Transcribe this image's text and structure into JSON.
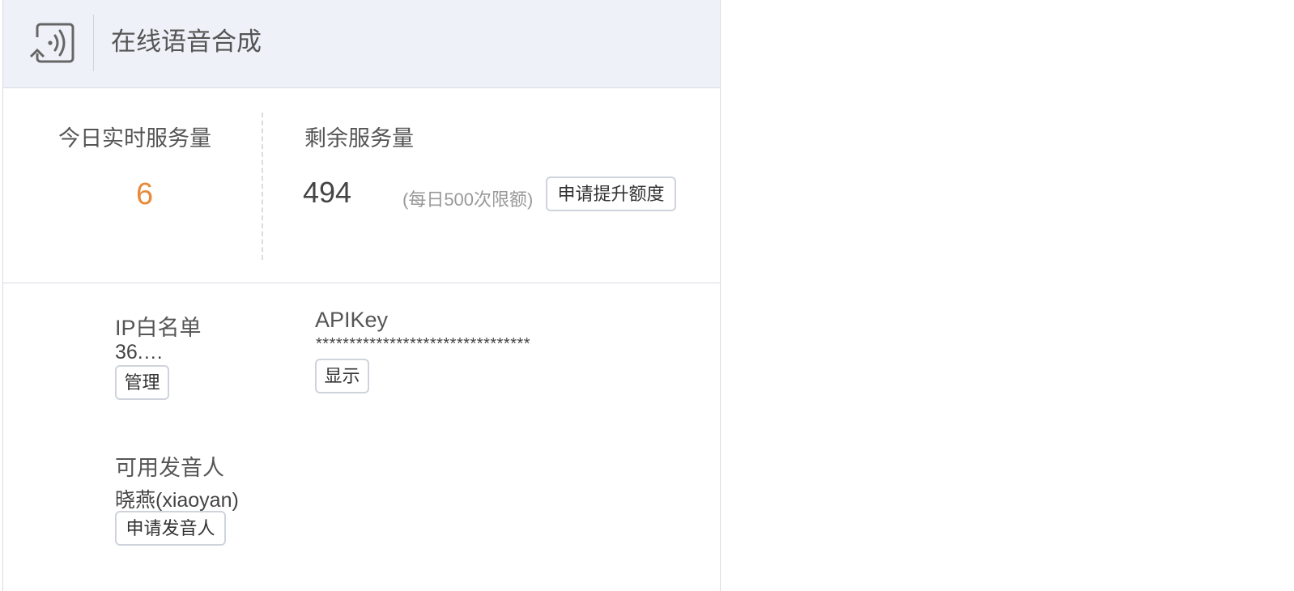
{
  "header": {
    "title": "在线语音合成",
    "icon": "speaker-broadcast-icon"
  },
  "stats": {
    "today_label": "今日实时服务量",
    "today_value": "6",
    "remaining_label": "剩余服务量",
    "remaining_value": "494",
    "limit_note": "(每日500次限额)",
    "upgrade_button": "申请提升额度",
    "accent_color": "#e88a3a"
  },
  "info": {
    "ip_whitelist_label": "IP白名单",
    "ip_whitelist_value": "36.…",
    "manage_button": "管理",
    "apikey_label": "APIKey",
    "apikey_value": "********************************",
    "show_button": "显示",
    "speaker_label": "可用发音人",
    "speaker_value": "晓燕(xiaoyan)",
    "apply_speaker_button": "申请发音人"
  }
}
